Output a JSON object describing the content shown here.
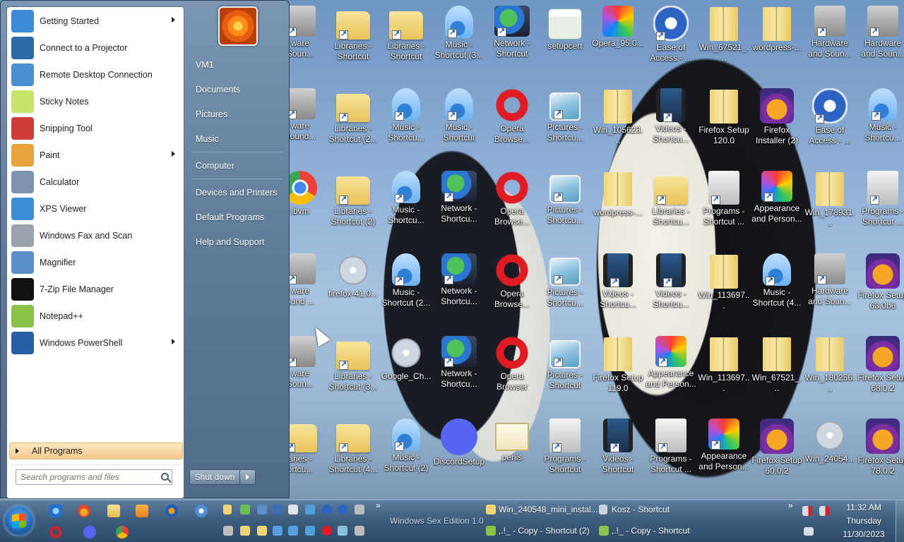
{
  "start_menu": {
    "programs": [
      {
        "label": "Getting Started",
        "icon": "getting-started-icon",
        "color": "#3a8ad8",
        "has_submenu": true
      },
      {
        "label": "Connect to a Projector",
        "icon": "projector-icon",
        "color": "#2c6aa8",
        "has_submenu": false
      },
      {
        "label": "Remote Desktop Connection",
        "icon": "remote-desktop-icon",
        "color": "#4a8fd0",
        "has_submenu": false
      },
      {
        "label": "Sticky Notes",
        "icon": "sticky-notes-icon",
        "color": "#c7e36a",
        "has_submenu": false
      },
      {
        "label": "Snipping Tool",
        "icon": "snipping-tool-icon",
        "color": "#d03b3b",
        "has_submenu": false
      },
      {
        "label": "Paint",
        "icon": "paint-icon",
        "color": "#e9a53a",
        "has_submenu": true
      },
      {
        "label": "Calculator",
        "icon": "calculator-icon",
        "color": "#7d93b0",
        "has_submenu": false
      },
      {
        "label": "XPS Viewer",
        "icon": "xps-viewer-icon",
        "color": "#3c8fd6",
        "has_submenu": false
      },
      {
        "label": "Windows Fax and Scan",
        "icon": "fax-scan-icon",
        "color": "#9aa3ad",
        "has_submenu": false
      },
      {
        "label": "Magnifier",
        "icon": "magnifier-icon",
        "color": "#5a8fc8",
        "has_submenu": false
      },
      {
        "label": "7-Zip File Manager",
        "icon": "7zip-icon",
        "color": "#111111",
        "has_submenu": false
      },
      {
        "label": "Notepad++",
        "icon": "notepadpp-icon",
        "color": "#8bc34a",
        "has_submenu": false
      },
      {
        "label": "Windows PowerShell",
        "icon": "powershell-icon",
        "color": "#2a5da8",
        "has_submenu": true
      }
    ],
    "all_programs_label": "All Programs",
    "search_placeholder": "Search programs and files",
    "right_items": [
      {
        "label": "VM1"
      },
      {
        "label": "Documents"
      },
      {
        "label": "Pictures"
      },
      {
        "label": "Music"
      },
      {
        "label": "Computer"
      },
      {
        "label": "Devices and Printers"
      },
      {
        "label": "Default Programs"
      },
      {
        "label": "Help and Support"
      }
    ],
    "shutdown_label": "Shut down"
  },
  "desktop_icons": [
    {
      "label": "ware\nSoun...",
      "kind": "hw",
      "shortcut": true
    },
    {
      "label": "Libraries -\nShortcut",
      "kind": "folder",
      "shortcut": true
    },
    {
      "label": "Libraries -\nShortcut",
      "kind": "folder",
      "shortcut": true
    },
    {
      "label": "Music -\nShortcut (3...",
      "kind": "music",
      "shortcut": true
    },
    {
      "label": "Network -\nShortcut",
      "kind": "net",
      "shortcut": true
    },
    {
      "label": "setupcert",
      "kind": "setupcert",
      "shortcut": false
    },
    {
      "label": "Opera_95.0...",
      "kind": "app",
      "shortcut": false
    },
    {
      "label": "Ease of\nAccess - ...",
      "kind": "ease",
      "shortcut": true
    },
    {
      "label": "Win_67521_...",
      "kind": "zip",
      "shortcut": false
    },
    {
      "label": "wordpress-...",
      "kind": "zip",
      "shortcut": false
    },
    {
      "label": "Hardware\nand Soun...",
      "kind": "hw",
      "shortcut": true
    },
    {
      "label": "Hardware\nand Soun...",
      "kind": "hw",
      "shortcut": true
    },
    {
      "label": "ware\nSound...",
      "kind": "hw",
      "shortcut": true
    },
    {
      "label": "Libraries -\nShortcut (2...",
      "kind": "folder",
      "shortcut": true
    },
    {
      "label": "Music -\nShortcu...",
      "kind": "music",
      "shortcut": true
    },
    {
      "label": "Music -\nShortcut",
      "kind": "music",
      "shortcut": true
    },
    {
      "label": "Opera\nBrowse...",
      "kind": "opera",
      "shortcut": false
    },
    {
      "label": "Pictures -\nShortcu...",
      "kind": "pics",
      "shortcut": true
    },
    {
      "label": "Win_105623...",
      "kind": "zip",
      "shortcut": false
    },
    {
      "label": "Videos -\nShortcu...",
      "kind": "video",
      "shortcut": true
    },
    {
      "label": "Firefox Setup\n120.0",
      "kind": "zip",
      "shortcut": false
    },
    {
      "label": "Firefox\nInstaller (2)",
      "kind": "ff",
      "shortcut": false
    },
    {
      "label": "Ease of\nAccess - ...",
      "kind": "ease",
      "shortcut": true
    },
    {
      "label": "Music -\nShortcu...",
      "kind": "music",
      "shortcut": true
    },
    {
      "label": "lbvm",
      "kind": "chrome",
      "shortcut": false
    },
    {
      "label": "Libraries -\nShortcut (2)",
      "kind": "folder",
      "shortcut": true
    },
    {
      "label": "Music -\nShortcu...",
      "kind": "music",
      "shortcut": true
    },
    {
      "label": "Network -\nShortcu...",
      "kind": "net",
      "shortcut": true
    },
    {
      "label": "Opera\nBrowse...",
      "kind": "opera",
      "shortcut": false
    },
    {
      "label": "Pictures -\nShortcu...",
      "kind": "pics",
      "shortcut": true
    },
    {
      "label": "wordpress-...",
      "kind": "zip",
      "shortcut": false
    },
    {
      "label": "Libraries -\nShortcu...",
      "kind": "folder",
      "shortcut": true
    },
    {
      "label": "Programs -\nShortcut ...",
      "kind": "prog",
      "shortcut": true
    },
    {
      "label": "Appearance\nand Person...",
      "kind": "app",
      "shortcut": true
    },
    {
      "label": "Win_178931...",
      "kind": "zip",
      "shortcut": false
    },
    {
      "label": "Programs -\nShortcut ...",
      "kind": "prog",
      "shortcut": true
    },
    {
      "label": "ware\nound ...",
      "kind": "hw",
      "shortcut": true
    },
    {
      "label": "firefox-41.0...",
      "kind": "cd",
      "shortcut": false
    },
    {
      "label": "Music -\nShortcut (2...",
      "kind": "music",
      "shortcut": true
    },
    {
      "label": "Network -\nShortcu...",
      "kind": "net",
      "shortcut": true
    },
    {
      "label": "Opera\nBrowse...",
      "kind": "opera",
      "shortcut": false
    },
    {
      "label": "Pictures -\nShortcu...",
      "kind": "pics",
      "shortcut": true
    },
    {
      "label": "Videos -\nShortcu...",
      "kind": "video",
      "shortcut": true
    },
    {
      "label": "Videos -\nShortcu...",
      "kind": "video",
      "shortcut": true
    },
    {
      "label": "Win_113697...",
      "kind": "zip",
      "shortcut": false
    },
    {
      "label": "Music -\nShortcut (4...",
      "kind": "music",
      "shortcut": true
    },
    {
      "label": "Hardware\nand Soun...",
      "kind": "hw",
      "shortcut": true
    },
    {
      "label": "Firefox Setup\n63.0b6",
      "kind": "ff",
      "shortcut": false
    },
    {
      "label": "ware\nSoun...",
      "kind": "hw",
      "shortcut": true
    },
    {
      "label": "Libraries -\nShortcut (3...",
      "kind": "folder",
      "shortcut": true
    },
    {
      "label": "Google_Ch...",
      "kind": "cd",
      "shortcut": false
    },
    {
      "label": "Network -\nShortcu...",
      "kind": "net",
      "shortcut": true
    },
    {
      "label": "Opera\nBrowser",
      "kind": "opera",
      "shortcut": false
    },
    {
      "label": "Pictures -\nShortcut",
      "kind": "pics",
      "shortcut": true
    },
    {
      "label": "Firefox Setup\n119.0",
      "kind": "zip",
      "shortcut": false
    },
    {
      "label": "Appearance\nand Person...",
      "kind": "app",
      "shortcut": true
    },
    {
      "label": "Win_113697...",
      "kind": "zip",
      "shortcut": false
    },
    {
      "label": "Win_67521_...",
      "kind": "zip",
      "shortcut": false
    },
    {
      "label": "Win_180256...",
      "kind": "zip",
      "shortcut": false
    },
    {
      "label": "Firefox Setup\n68.0.2",
      "kind": "ff",
      "shortcut": false
    },
    {
      "label": "aries -\nortcu...",
      "kind": "folder",
      "shortcut": true
    },
    {
      "label": "Libraries -\nShortcut (4...",
      "kind": "folder",
      "shortcut": true
    },
    {
      "label": "Music -\nShortcut (2)",
      "kind": "music",
      "shortcut": true
    },
    {
      "label": "DiscordSetup",
      "kind": "disc",
      "shortcut": false
    },
    {
      "label": "penis",
      "kind": "cert",
      "shortcut": false
    },
    {
      "label": "Programs -\nShortcut",
      "kind": "prog",
      "shortcut": true
    },
    {
      "label": "Videos -\nShortcut",
      "kind": "video",
      "shortcut": true
    },
    {
      "label": "Programs -\nShortcut ...",
      "kind": "prog",
      "shortcut": true
    },
    {
      "label": "Appearance\nand Person...",
      "kind": "app",
      "shortcut": true
    },
    {
      "label": "Firefox Setup\n60.0.2",
      "kind": "ff",
      "shortcut": false
    },
    {
      "label": "Win_24054...",
      "kind": "cd",
      "shortcut": false
    },
    {
      "label": "Firefox Setup\n78.0.2",
      "kind": "ff",
      "shortcut": false
    }
  ],
  "taskbar": {
    "watermark": "Windows Sex Edition 1.0",
    "window_buttons": [
      {
        "label": "Win_240548_mini_instal..."
      },
      {
        "label": "Kosz - Shortcut"
      },
      {
        "label": ",.!_ - Copy - Shortcut (2)"
      },
      {
        "label": ",.!_ - Copy - Shortcut"
      }
    ],
    "chevron": "»",
    "clock": {
      "time": "11:32 AM",
      "day": "Thursday",
      "date": "11/30/2023"
    }
  }
}
